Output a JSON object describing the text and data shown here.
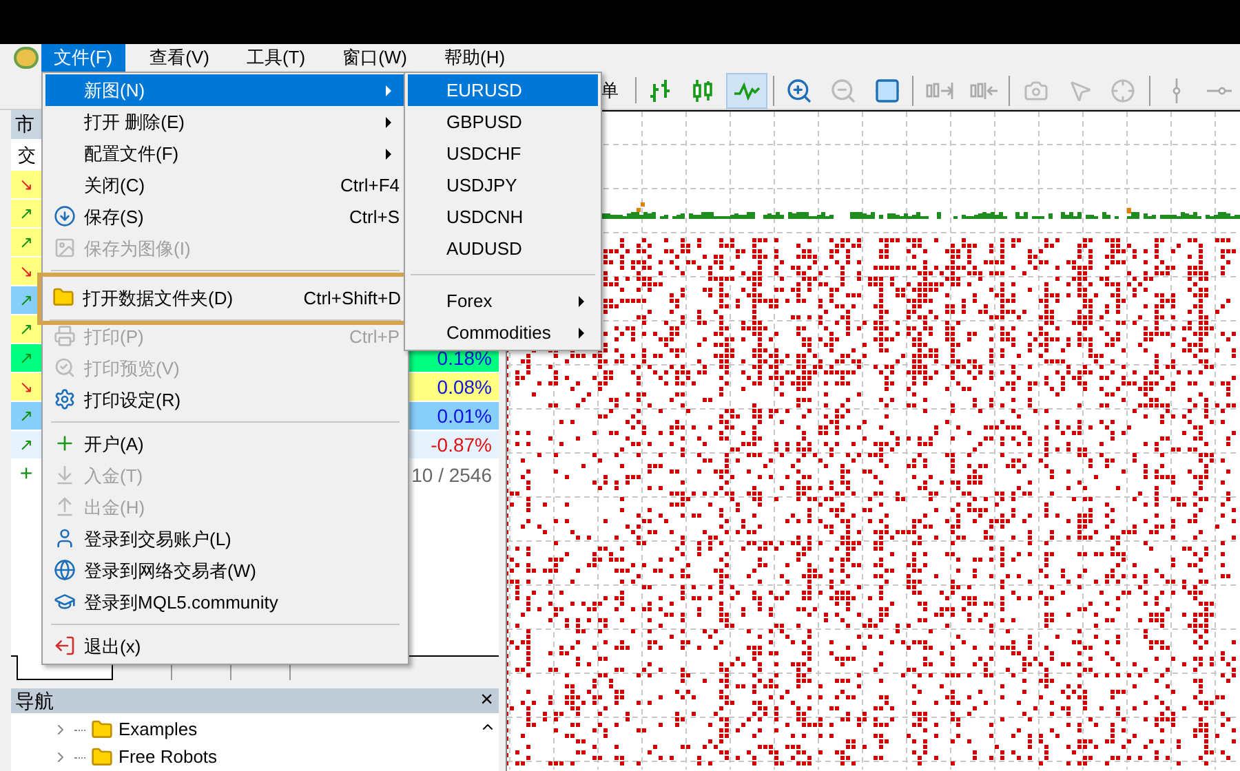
{
  "menu_bar": [
    {
      "label": "文件(F)",
      "selected": true
    },
    {
      "label": "查看(V)",
      "selected": false
    },
    {
      "label": "工具(T)",
      "selected": false
    },
    {
      "label": "窗口(W)",
      "selected": false
    },
    {
      "label": "帮助(H)",
      "selected": false
    }
  ],
  "toolbar": {
    "label": "单",
    "line_chart_selected": true
  },
  "market_watch": {
    "title": "市",
    "column_header": "交",
    "rows": [
      {
        "arrow": {
          "glyph": "↘",
          "color": "#e02020"
        },
        "color": "#ffff80"
      },
      {
        "arrow": {
          "glyph": "↗",
          "color": "#109010"
        },
        "color": "#ffff80"
      },
      {
        "arrow": {
          "glyph": "↗",
          "color": "#109010"
        },
        "color": "#ffff80"
      },
      {
        "arrow": {
          "glyph": "↘",
          "color": "#e02020"
        },
        "color": "#ffff80"
      },
      {
        "arrow": {
          "glyph": "↗",
          "color": "#109010"
        },
        "color": "#87cefa"
      },
      {
        "arrow": {
          "glyph": "↗",
          "color": "#109010"
        },
        "color": "#ffff80"
      },
      {
        "arrow": {
          "glyph": "↗",
          "color": "#109010"
        },
        "color": "#00ff80",
        "change": "0.18%",
        "negative": false
      },
      {
        "arrow": {
          "glyph": "↘",
          "color": "#e02020"
        },
        "color": "#ffff80",
        "change": "0.08%",
        "negative": false
      },
      {
        "arrow": {
          "glyph": "↗",
          "color": "#109010"
        },
        "color": "#87cefa",
        "change": "0.01%",
        "negative": false
      },
      {
        "arrow": {
          "glyph": "↗",
          "color": "#109010"
        },
        "color": "#e6f2ff",
        "change": "-0.87%",
        "negative": true
      }
    ],
    "add_symbol": "+",
    "count": "10 / 2546",
    "tabs": [
      {
        "selected": true
      },
      {
        "selected": false
      },
      {
        "selected": false
      },
      {
        "selected": false
      }
    ]
  },
  "navigator": {
    "title": "导航",
    "close": "×",
    "items": [
      {
        "label": "Examples"
      },
      {
        "label": "Free Robots"
      }
    ]
  },
  "file_menu": {
    "items": [
      {
        "kind": "item",
        "label": "新图(N)",
        "submenu": true,
        "selected": true,
        "disabled": false,
        "outlined": false
      },
      {
        "kind": "item",
        "label": "打开 删除(E)",
        "submenu": true,
        "selected": false,
        "disabled": false,
        "outlined": false
      },
      {
        "kind": "item",
        "label": "配置文件(F)",
        "submenu": true,
        "selected": false,
        "disabled": false,
        "outlined": false
      },
      {
        "kind": "item",
        "label": "关闭(C)",
        "shortcut": "Ctrl+F4",
        "submenu": false,
        "selected": false,
        "disabled": false,
        "outlined": false
      },
      {
        "kind": "item",
        "label": "保存(S)",
        "shortcut": "Ctrl+S",
        "submenu": false,
        "selected": false,
        "disabled": false,
        "outlined": false
      },
      {
        "kind": "item",
        "label": "保存为图像(I)",
        "submenu": false,
        "selected": false,
        "disabled": true,
        "outlined": false
      },
      {
        "kind": "separator"
      },
      {
        "kind": "item",
        "label": "打开数据文件夹(D)",
        "shortcut": "Ctrl+Shift+D",
        "submenu": false,
        "selected": false,
        "disabled": false,
        "outlined": true
      },
      {
        "kind": "separator"
      },
      {
        "kind": "item",
        "label": "打印(P)",
        "shortcut": "Ctrl+P",
        "submenu": false,
        "selected": false,
        "disabled": true,
        "outlined": false
      },
      {
        "kind": "item",
        "label": "打印预览(V)",
        "submenu": false,
        "selected": false,
        "disabled": true,
        "outlined": false
      },
      {
        "kind": "item",
        "label": "打印设定(R)",
        "submenu": false,
        "selected": false,
        "disabled": false,
        "outlined": false
      },
      {
        "kind": "separator"
      },
      {
        "kind": "item",
        "label": "开户(A)",
        "submenu": false,
        "selected": false,
        "disabled": false,
        "outlined": false
      },
      {
        "kind": "item",
        "label": "入金(T)",
        "submenu": false,
        "selected": false,
        "disabled": true,
        "outlined": false
      },
      {
        "kind": "item",
        "label": "出金(H)",
        "submenu": false,
        "selected": false,
        "disabled": true,
        "outlined": false
      },
      {
        "kind": "item",
        "label": "登录到交易账户(L)",
        "submenu": false,
        "selected": false,
        "disabled": false,
        "outlined": false
      },
      {
        "kind": "item",
        "label": "登录到网络交易者(W)",
        "submenu": false,
        "selected": false,
        "disabled": false,
        "outlined": false
      },
      {
        "kind": "item",
        "label": "登录到MQL5.community",
        "submenu": false,
        "selected": false,
        "disabled": false,
        "outlined": false
      },
      {
        "kind": "separator"
      },
      {
        "kind": "item",
        "label": "退出(x)",
        "submenu": false,
        "selected": false,
        "disabled": false,
        "outlined": false
      }
    ]
  },
  "new_chart_submenu": {
    "items": [
      {
        "kind": "item",
        "label": "EURUSD",
        "selected": true,
        "submenu": false
      },
      {
        "kind": "item",
        "label": "GBPUSD",
        "selected": false,
        "submenu": false
      },
      {
        "kind": "item",
        "label": "USDCHF",
        "selected": false,
        "submenu": false
      },
      {
        "kind": "item",
        "label": "USDJPY",
        "selected": false,
        "submenu": false
      },
      {
        "kind": "item",
        "label": "USDCNH",
        "selected": false,
        "submenu": false
      },
      {
        "kind": "item",
        "label": "AUDUSD",
        "selected": false,
        "submenu": false
      },
      {
        "kind": "separator"
      },
      {
        "kind": "item",
        "label": "Forex",
        "selected": false,
        "submenu": true
      },
      {
        "kind": "item",
        "label": "Commodities",
        "selected": false,
        "submenu": true
      }
    ]
  }
}
